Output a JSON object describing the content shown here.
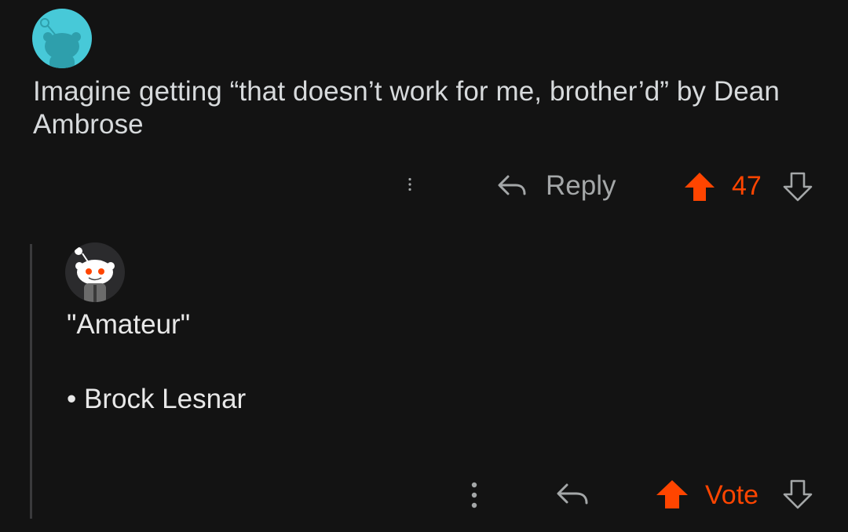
{
  "colors": {
    "background": "#131313",
    "text": "#d7dadc",
    "accent": "#ff4500",
    "muted": "#a4a7a8"
  },
  "comment": {
    "avatar": "snoo-avatar-cyan",
    "body": "Imagine getting “that doesn’t work for me, brother’d” by Dean Ambrose",
    "actions": {
      "more": "kebab-icon",
      "reply_icon": "reply-arrow-icon",
      "reply_label": "Reply",
      "upvote_icon": "upvote-arrow-icon",
      "score": "47",
      "downvote_icon": "downvote-arrow-icon",
      "upvoted": true
    }
  },
  "reply": {
    "avatar": "snoo-avatar-dark",
    "lines": [
      "\"Amateur\"",
      "• Brock Lesnar"
    ],
    "actions": {
      "more": "kebab-icon",
      "reply_icon": "reply-arrow-icon",
      "upvote_icon": "upvote-arrow-icon",
      "vote_label": "Vote",
      "downvote_icon": "downvote-arrow-icon"
    }
  }
}
